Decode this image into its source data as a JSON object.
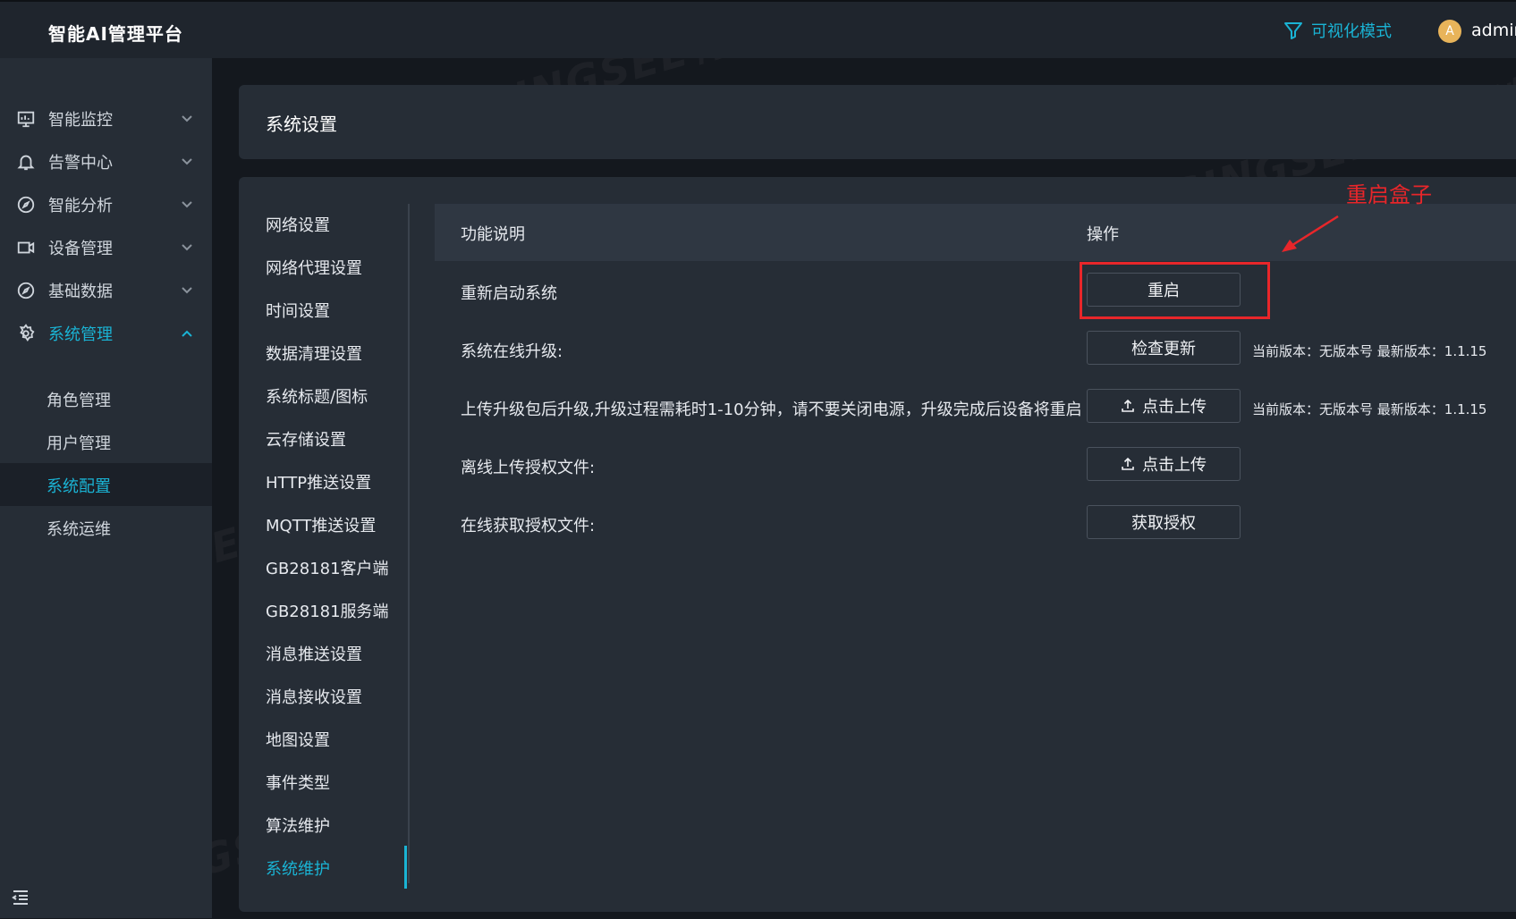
{
  "app": {
    "title": "智能AI管理平台"
  },
  "header": {
    "viz_mode": "可视化模式",
    "avatar_letter": "A",
    "username": "admin"
  },
  "sidebar": {
    "items": [
      {
        "label": "智能监控",
        "icon": "monitor-icon"
      },
      {
        "label": "告警中心",
        "icon": "bell-icon"
      },
      {
        "label": "智能分析",
        "icon": "compass-icon"
      },
      {
        "label": "设备管理",
        "icon": "camera-icon"
      },
      {
        "label": "基础数据",
        "icon": "compass-icon"
      },
      {
        "label": "系统管理",
        "icon": "gear-icon",
        "expanded": true,
        "active": true
      }
    ],
    "sub_items": [
      {
        "label": "角色管理"
      },
      {
        "label": "用户管理"
      },
      {
        "label": "系统配置",
        "active": true
      },
      {
        "label": "系统运维"
      }
    ]
  },
  "page": {
    "title": "系统设置"
  },
  "settings_menu": {
    "items": [
      "网络设置",
      "网络代理设置",
      "时间设置",
      "数据清理设置",
      "系统标题/图标",
      "云存储设置",
      "HTTP推送设置",
      "MQTT推送设置",
      "GB28181客户端",
      "GB28181服务端",
      "消息推送设置",
      "消息接收设置",
      "地图设置",
      "事件类型",
      "算法维护",
      "系统维护"
    ],
    "active": "系统维护"
  },
  "table": {
    "headers": {
      "description": "功能说明",
      "action": "操作"
    },
    "rows": [
      {
        "description": "重新启动系统",
        "button": "重启"
      },
      {
        "description": "系统在线升级:",
        "button": "检查更新",
        "info": "当前版本：无版本号  最新版本：1.1.15"
      },
      {
        "description": "上传升级包后升级,升级过程需耗时1-10分钟，请不要关闭电源，升级完成后设备将重启",
        "button": "点击上传",
        "icon": "upload-icon",
        "info": "当前版本：无版本号  最新版本：1.1.15"
      },
      {
        "description": "离线上传授权文件:",
        "button": "点击上传",
        "icon": "upload-icon"
      },
      {
        "description": "在线获取授权文件:",
        "button": "获取授权"
      }
    ]
  },
  "annotation": {
    "text": "重启盒子",
    "color": "#e8262a"
  },
  "watermark": {
    "text": "TSINGSEE青犀视频"
  },
  "colors": {
    "accent": "#1ab3d4",
    "sidebar_bg": "#262d36",
    "page_bg": "#14181e"
  }
}
